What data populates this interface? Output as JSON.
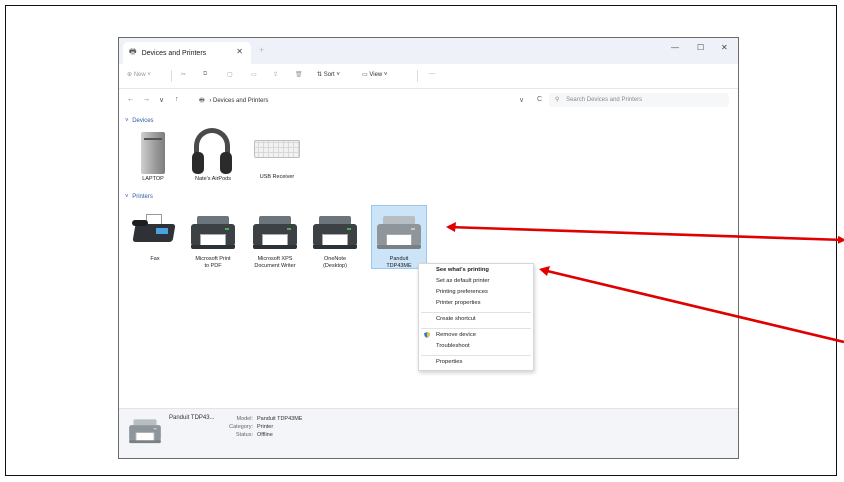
{
  "window": {
    "tab_title": "Devices and Printers",
    "tab_close": "✕",
    "new_tab": "+",
    "minimize": "—",
    "maximize": "☐",
    "close": "✕"
  },
  "toolbar": {
    "new_label": "New",
    "sort_label": "Sort",
    "view_label": "View",
    "more_label": "···"
  },
  "address": {
    "back": "←",
    "forward": "→",
    "recent": "∨",
    "up": "↑",
    "breadcrumb": "Devices and Printers",
    "dropdown": "∨",
    "refresh": "C",
    "search_placeholder": "Search Devices and Printers"
  },
  "sections": {
    "devices": "Devices",
    "printers": "Printers"
  },
  "devices": [
    {
      "label": "LAPTOP",
      "icon": "tower-computer-icon"
    },
    {
      "label": "Nate's AirPods",
      "icon": "headphones-icon"
    },
    {
      "label": "USB Receiver",
      "icon": "keyboard-icon"
    }
  ],
  "printers": [
    {
      "label_lines": [
        "Fax"
      ],
      "icon": "fax-icon"
    },
    {
      "label_lines": [
        "Microsoft Print",
        "to PDF"
      ],
      "icon": "printer-icon"
    },
    {
      "label_lines": [
        "Microsoft XPS",
        "Document Writer"
      ],
      "icon": "printer-icon"
    },
    {
      "label_lines": [
        "OneNote",
        "(Desktop)"
      ],
      "icon": "printer-icon"
    },
    {
      "label_lines": [
        "Panduit",
        "TDP43ME"
      ],
      "icon": "printer-offline-icon",
      "selected": true
    }
  ],
  "context_menu": {
    "items": [
      "See what's printing",
      "Set as default printer",
      "Printing preferences",
      "Printer properties",
      "Create shortcut",
      "Remove device",
      "Troubleshoot",
      "Properties"
    ]
  },
  "details": {
    "name": "Panduit TDP43...",
    "model_label": "Model:",
    "model_value": "Panduit TDP43ME",
    "category_label": "Category:",
    "category_value": "Printer",
    "status_label": "Status:",
    "status_value": "Offline"
  },
  "colors": {
    "annotation_arrow": "#e00000",
    "selection": "#cce4f7",
    "section_heading": "#2d5aa8"
  }
}
